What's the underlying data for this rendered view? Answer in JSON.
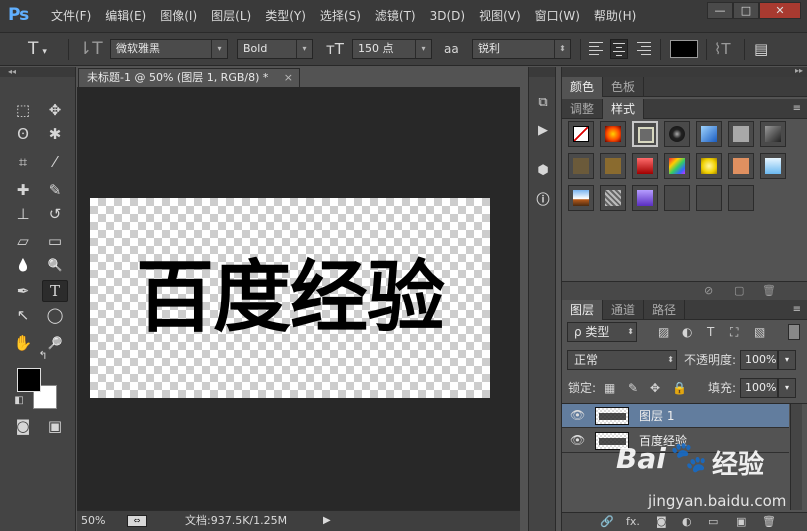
{
  "app": {
    "logo": "Ps"
  },
  "menu": [
    "文件(F)",
    "编辑(E)",
    "图像(I)",
    "图层(L)",
    "类型(Y)",
    "选择(S)",
    "滤镜(T)",
    "3D(D)",
    "视图(V)",
    "窗口(W)",
    "帮助(H)"
  ],
  "window_controls": {
    "minimize": "—",
    "maximize": "□",
    "close": "✕"
  },
  "options": {
    "tool_glyph": "T",
    "font_family": "微软雅黑",
    "font_style": "Bold",
    "font_size": "150 点",
    "aa_icon": "aa",
    "antialias": "锐利",
    "text_color": "#000000"
  },
  "document": {
    "tab_title": "未标题-1 @ 50% (图层 1, RGB/8) *",
    "tab_close": "×",
    "canvas_text": "百度经验",
    "zoom": "50%",
    "doc_info": "文档:937.5K/1.25M",
    "play_icon": "▶"
  },
  "tools": {
    "panel_collapse": "◂◂",
    "items": [
      {
        "name": "rect-marquee",
        "glyph": "⬚"
      },
      {
        "name": "move",
        "glyph": "✥"
      },
      {
        "name": "lasso",
        "glyph": "ʘ"
      },
      {
        "name": "magic-wand",
        "glyph": "✱"
      },
      {
        "name": "crop",
        "glyph": "⌗"
      },
      {
        "name": "eyedropper",
        "glyph": "⁄"
      },
      {
        "name": "healing",
        "glyph": "✚"
      },
      {
        "name": "brush",
        "glyph": "✎"
      },
      {
        "name": "stamp",
        "glyph": "⊥"
      },
      {
        "name": "history-brush",
        "glyph": "↺"
      },
      {
        "name": "eraser",
        "glyph": "▱"
      },
      {
        "name": "gradient",
        "glyph": "▭"
      },
      {
        "name": "blur",
        "glyph": "💧"
      },
      {
        "name": "dodge",
        "glyph": "🔍"
      },
      {
        "name": "pen",
        "glyph": "✒"
      },
      {
        "name": "type",
        "glyph": "T"
      },
      {
        "name": "path-select",
        "glyph": "↖"
      },
      {
        "name": "ellipse",
        "glyph": "◯"
      },
      {
        "name": "hand",
        "glyph": "✋"
      },
      {
        "name": "zoom",
        "glyph": "🔎"
      },
      {
        "name": "quick-mask",
        "glyph": "◙"
      },
      {
        "name": "screen-mode",
        "glyph": "▣"
      }
    ],
    "swap_icon": "↰",
    "default_icon": "◧",
    "fg_color": "#000000",
    "bg_color": "#ffffff"
  },
  "dock": {
    "collapse": "▸▸",
    "icons": [
      "history",
      "play",
      "3d",
      "info"
    ]
  },
  "color_panel": {
    "tabs": [
      "颜色",
      "色板"
    ],
    "collapse": "▸▸"
  },
  "styles_panel": {
    "tabs": [
      "调整",
      "样式"
    ],
    "menu_icon": "≡",
    "swatches": [
      {
        "bg": "#ffffff",
        "kind": "none"
      },
      {
        "bg": "#ff6a00",
        "kind": "orange-glow"
      },
      {
        "bg": "#777777",
        "kind": "frame"
      },
      {
        "bg": "#202020",
        "kind": "dark-circle"
      },
      {
        "bg": "#3b8fd8",
        "kind": "blue-ribbon"
      },
      {
        "bg": "#a8a8a8",
        "kind": "grey"
      },
      {
        "bg": "#5b5b5b",
        "kind": "dark-metal"
      },
      {
        "bg": "#6b5a3a",
        "kind": "brown"
      },
      {
        "bg": "#8a6b2f",
        "kind": "gold-brown"
      },
      {
        "bg": "#c42020",
        "kind": "red"
      },
      {
        "bg": "#d4358a",
        "kind": "multicolor"
      },
      {
        "bg": "#f0d800",
        "kind": "yellow"
      },
      {
        "bg": "#e09060",
        "kind": "peach"
      },
      {
        "bg": "#8ec8ff",
        "kind": "light-blue"
      },
      {
        "bg": "#5a7ab0",
        "kind": "sky"
      },
      {
        "bg": "#c0c0c0",
        "kind": "pattern"
      },
      {
        "bg": "#7a5ae0",
        "kind": "purple"
      },
      {
        "bg": "#4e4e4e",
        "kind": "empty"
      },
      {
        "bg": "#4a4a4a",
        "kind": "empty"
      },
      {
        "bg": "#4a4a4a",
        "kind": "empty"
      }
    ],
    "footer": [
      "⊘",
      "▢",
      "🗑"
    ]
  },
  "layers_panel": {
    "tabs": [
      "图层",
      "通道",
      "路径"
    ],
    "menu_icon": "≡",
    "filter_label": "ρ 类型",
    "filter_icons": [
      "▨",
      "◐",
      "T",
      "⛶",
      "▧"
    ],
    "blend_mode": "正常",
    "opacity_label": "不透明度:",
    "opacity_value": "100%",
    "lock_label": "锁定:",
    "lock_icons": [
      "▦",
      "✎",
      "✥",
      "🔒"
    ],
    "fill_label": "填充:",
    "fill_value": "100%",
    "layers": [
      {
        "name": "图层 1",
        "selected": true,
        "visible_icon": "👁"
      },
      {
        "name": "百度经验",
        "selected": false,
        "visible_icon": "👁"
      }
    ],
    "footer": [
      "🔗",
      "fx.",
      "◙",
      "◐",
      "▭",
      "▣",
      "🗑"
    ]
  },
  "watermark": {
    "brand": "Bai",
    "paw": "🐾",
    "brand_suffix": "经验",
    "url": "jingyan.baidu.com"
  }
}
